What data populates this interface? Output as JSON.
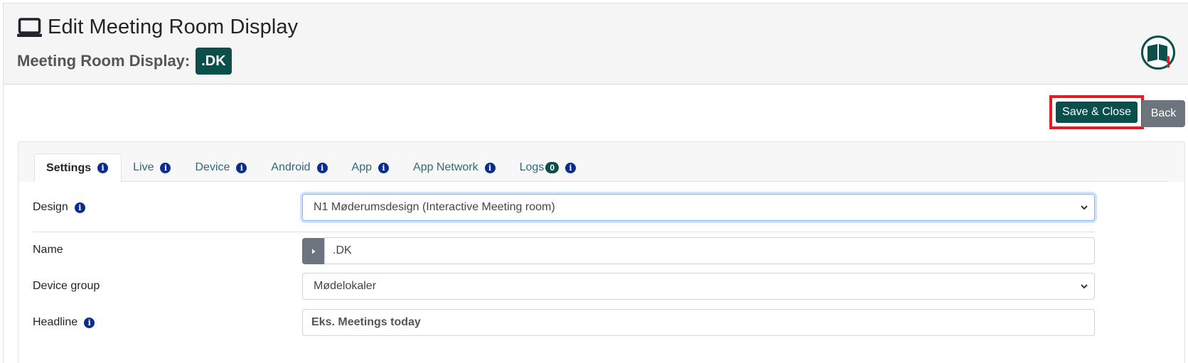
{
  "header": {
    "title": "Edit Meeting Room Display",
    "subtitle_label": "Meeting Room Display:",
    "display_badge": ".DK"
  },
  "toolbar": {
    "save_label": "Save & Close",
    "back_label": "Back"
  },
  "tabs": [
    {
      "label": "Settings",
      "active": true
    },
    {
      "label": "Live"
    },
    {
      "label": "Device"
    },
    {
      "label": "Android"
    },
    {
      "label": "App"
    },
    {
      "label": "App Network"
    },
    {
      "label": "Logs",
      "badge": "0"
    }
  ],
  "form": {
    "design": {
      "label": "Design",
      "value": "N1 Møderumsdesign (Interactive Meeting room)"
    },
    "name": {
      "label": "Name",
      "value": ".DK"
    },
    "device_group": {
      "label": "Device group",
      "value": "Mødelokaler"
    },
    "headline": {
      "label": "Headline",
      "placeholder": "Eks. Meetings today"
    }
  },
  "colors": {
    "brand": "#0b4f4c",
    "info_icon": "#0a2b8f",
    "highlight": "#e11d23",
    "secondary": "#6c757d"
  },
  "icons": {
    "title": "monitor-icon",
    "help": "book-help-icon",
    "info": "info-icon",
    "select": "chevron-down-icon",
    "name_toggle": "caret-right-icon"
  }
}
